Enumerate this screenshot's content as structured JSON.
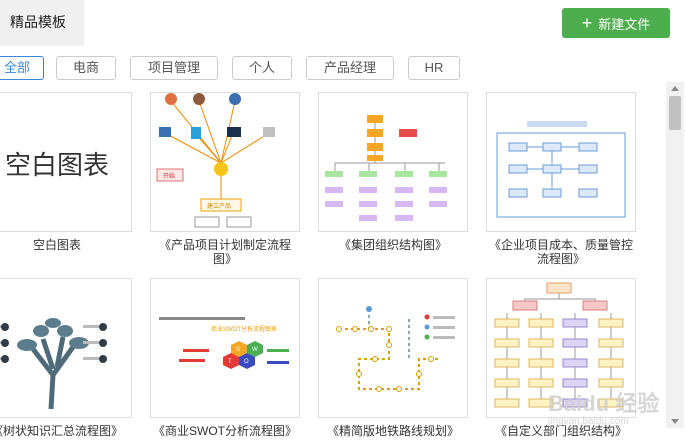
{
  "header": {
    "active_tab": "精品模板",
    "new_button": "新建文件"
  },
  "filters": [
    {
      "label": "全部",
      "active": true
    },
    {
      "label": "电商",
      "active": false
    },
    {
      "label": "项目管理",
      "active": false
    },
    {
      "label": "个人",
      "active": false
    },
    {
      "label": "产品经理",
      "active": false
    },
    {
      "label": "HR",
      "active": false
    }
  ],
  "cards": [
    {
      "caption": "空白图表",
      "thumb_text": "空白图表"
    },
    {
      "caption": "《产品项目计划制定流程图》"
    },
    {
      "caption": "《集团组织结构图》"
    },
    {
      "caption": "《企业项目成本、质量管控流程图》"
    },
    {
      "caption": "《树状知识汇总流程图》"
    },
    {
      "caption": "《商业SWOT分析流程图》"
    },
    {
      "caption": "《精简版地铁路线规划》"
    },
    {
      "caption": "《自定义部门组织结构》"
    }
  ],
  "thumb_labels": {
    "product_start": "开始",
    "product_build": "建立产品",
    "swot_title": "商业SWOT分析流程图表",
    "swot_s": "S",
    "swot_w": "W",
    "swot_o": "O",
    "swot_t": "T"
  },
  "watermark": {
    "text": "Baidu 经验",
    "sub": "jingyan.baidu.com"
  },
  "colors": {
    "accent_green": "#4cae4c",
    "accent_blue": "#3b87d9"
  }
}
